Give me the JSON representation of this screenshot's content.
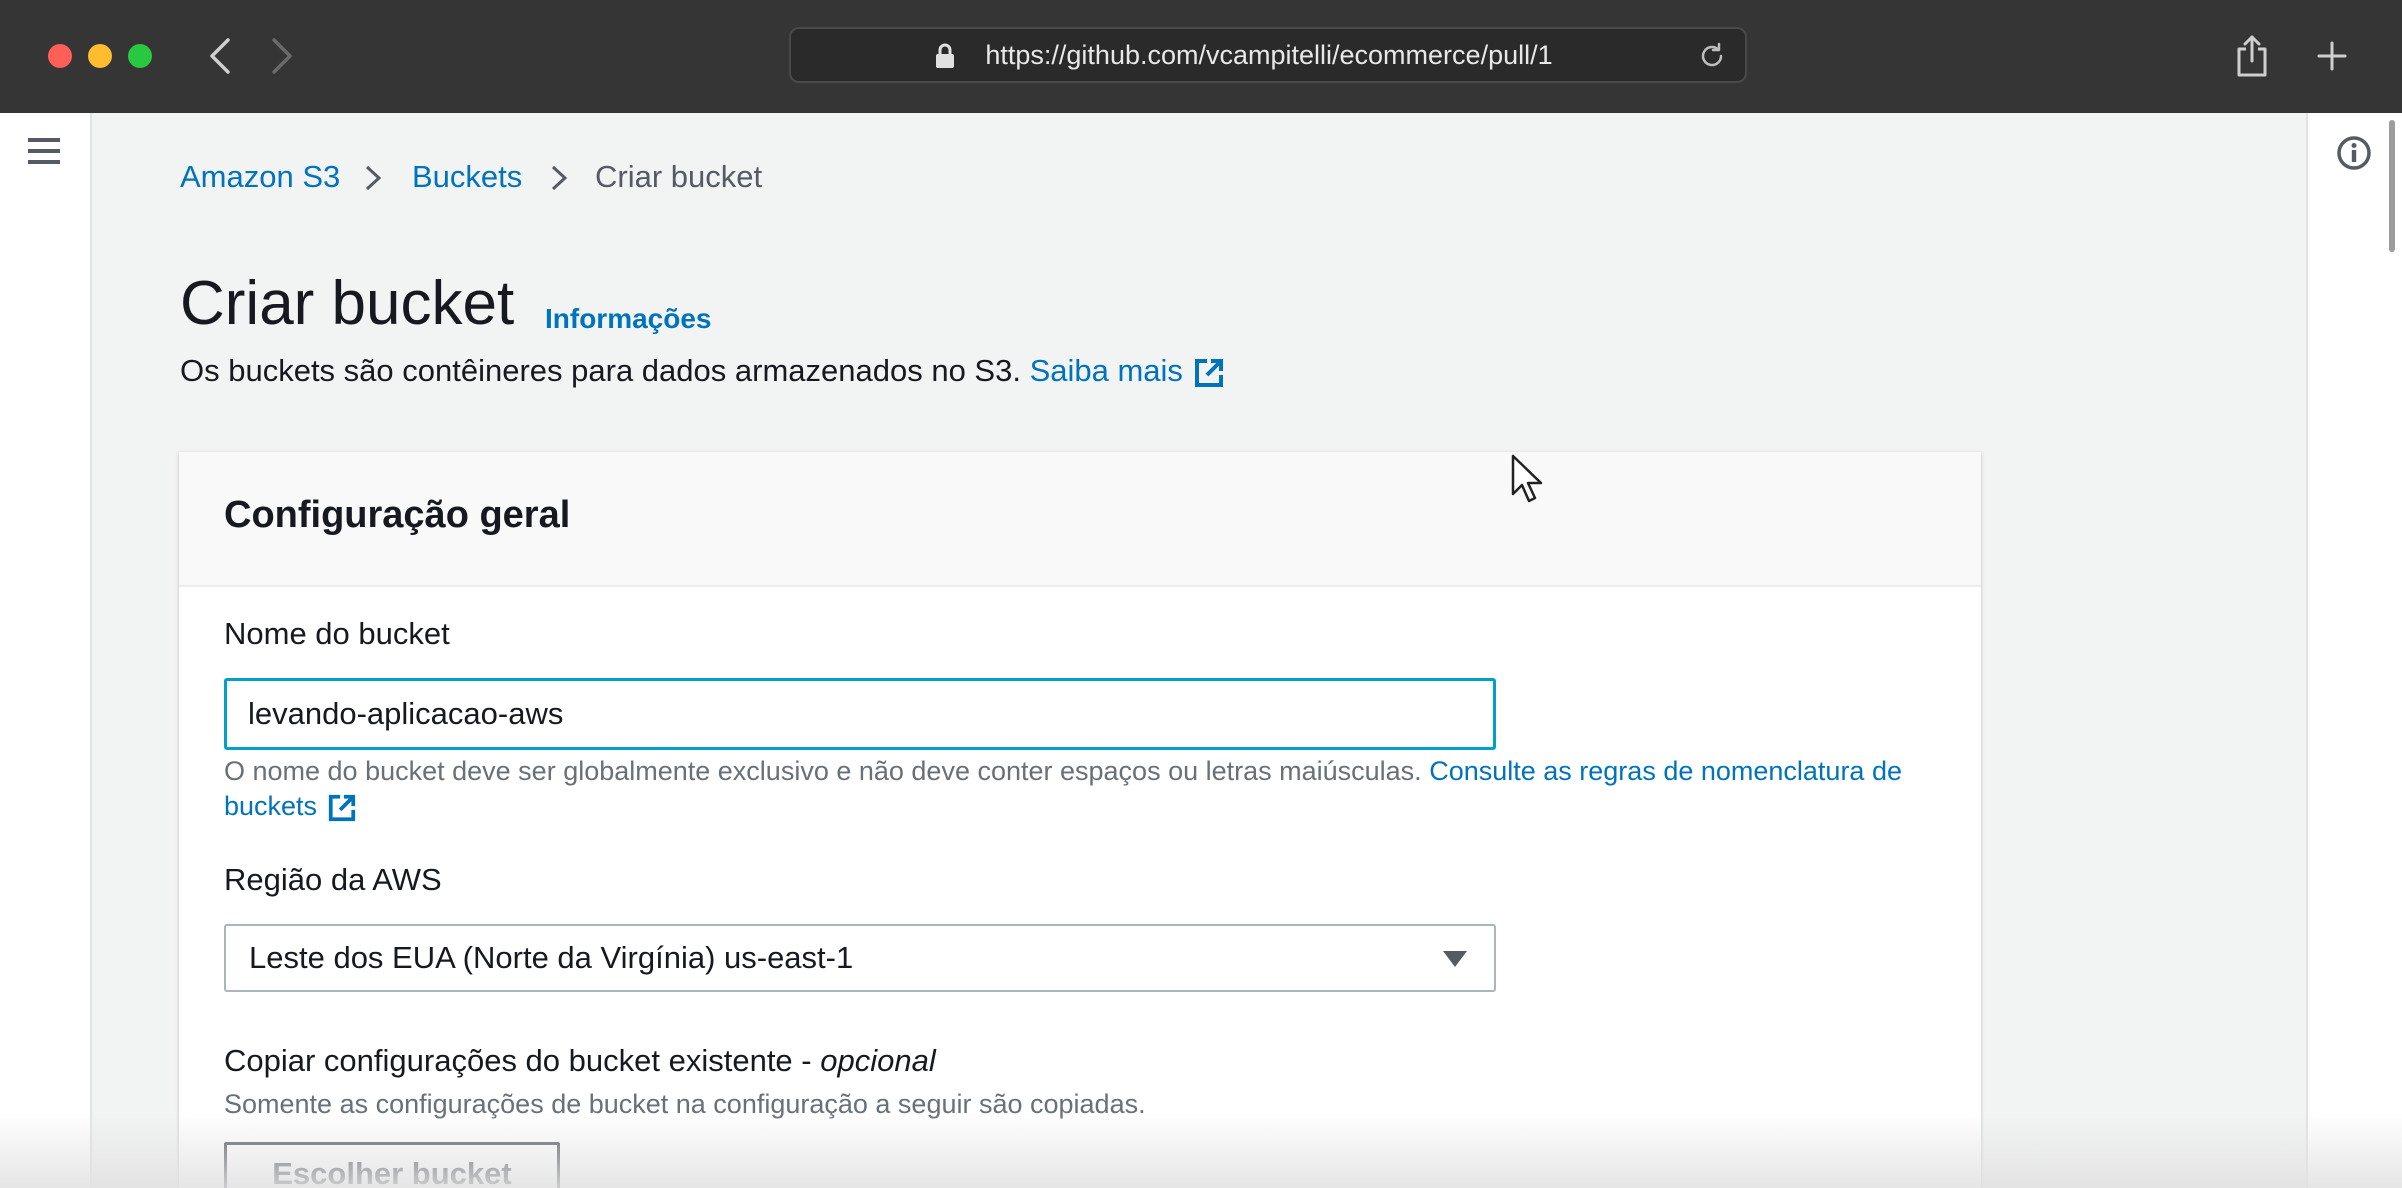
{
  "browser": {
    "url": "https://github.com/vcampitelli/ecommerce/pull/1",
    "icons": {
      "back": "chevron-left-icon",
      "forward": "chevron-right-icon",
      "lock": "lock-icon",
      "reload": "reload-icon",
      "share": "share-icon",
      "new_tab": "plus-icon"
    }
  },
  "sidebar": {
    "menu_icon": "hamburger-menu-icon"
  },
  "right_panel": {
    "info_icon": "info-icon"
  },
  "breadcrumb": {
    "items": [
      "Amazon S3",
      "Buckets",
      "Criar bucket"
    ]
  },
  "page": {
    "title": "Criar bucket",
    "info_link": "Informações",
    "subtitle": "Os buckets são contêineres para dados armazenados no S3.",
    "learn_more": "Saiba mais"
  },
  "general_config": {
    "title": "Configuração geral",
    "bucket_name": {
      "label": "Nome do bucket",
      "value": "levando-aplicacao-aws",
      "hint": "O nome do bucket deve ser globalmente exclusivo e não deve conter espaços ou letras maiúsculas.",
      "hint_link": "Consulte as regras de nomenclatura de buckets"
    },
    "region": {
      "label": "Região da AWS",
      "selected": "Leste dos EUA (Norte da Virgínia) us-east-1"
    },
    "copy_settings": {
      "label": "Copiar configurações do bucket existente - ",
      "label_optional": "opcional",
      "description": "Somente as configurações de bucket na configuração a seguir são copiadas.",
      "button": "Escolher bucket"
    }
  },
  "colors": {
    "link": "#0073bb",
    "focus_border": "#00a1c9",
    "titlebar": "#353535",
    "page_bg": "#f2f3f3"
  }
}
